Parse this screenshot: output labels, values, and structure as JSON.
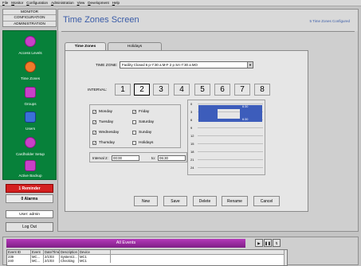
{
  "menu": [
    "File",
    "Monitor",
    "Configuration",
    "Administration",
    "View",
    "Development",
    "Help"
  ],
  "nav": {
    "top_items": [
      "MONITOR",
      "CONFIGURATION",
      "ADMINISTRATION"
    ],
    "items": [
      {
        "label": "Access Levels",
        "icon": "no-entry-icon"
      },
      {
        "label": "Time Zones",
        "icon": "clock-icon"
      },
      {
        "label": "Groups",
        "icon": "groups-icon"
      },
      {
        "label": "Users",
        "icon": "user-icon"
      },
      {
        "label": "Cardholder Setup",
        "icon": "cardholder-icon"
      },
      {
        "label": "Active Backup",
        "icon": "backup-icon"
      }
    ],
    "reminder": "1 Reminder",
    "alarms": "0 Alarms",
    "user": "User: admin",
    "logout": "Log Out"
  },
  "screen": {
    "title": "Time Zones Screen",
    "configured": "5 Time Zones Configured",
    "tabs": [
      "Time Zones",
      "Holidays"
    ],
    "tz_label": "TIME ZONE:",
    "tz_value": "Facility Closed 6 p-7:30 a M-F 2 p SA-7:30 a MO",
    "interval_label": "INTERVAL:",
    "intervals": [
      "1",
      "2",
      "3",
      "4",
      "5",
      "6",
      "7",
      "8"
    ],
    "selected_interval": "2",
    "days": [
      {
        "label": "Monday",
        "checked": true
      },
      {
        "label": "Tuesday",
        "checked": true
      },
      {
        "label": "Wednesday",
        "checked": true
      },
      {
        "label": "Thursday",
        "checked": true
      },
      {
        "label": "Friday",
        "checked": true
      },
      {
        "label": "Saturday",
        "checked": false
      },
      {
        "label": "Sunday",
        "checked": false
      },
      {
        "label": "Holidays",
        "checked": false
      }
    ],
    "interval2_label": "Interval 2:",
    "interval2_from": "00:00",
    "interval2_to_label": "to:",
    "interval2_to": "06:30",
    "timeline_ticks": [
      "0",
      "3",
      "6",
      "9",
      "12",
      "15",
      "18",
      "21",
      "24"
    ],
    "timeline_bar_labels": [
      "6:30",
      "6:30"
    ],
    "buttons": [
      "New",
      "Save",
      "Delete",
      "Rename",
      "Cancel"
    ]
  },
  "events": {
    "title": "All Events",
    "controls": [
      "▶",
      "❚❚",
      "↯"
    ],
    "columns": [
      "Event ID",
      "Event",
      "Date/Time",
      "Description",
      "Device"
    ],
    "rows": [
      [
        "239",
        "MC...",
        "2/1/03",
        "System/J...",
        "MC1"
      ],
      [
        "240",
        "MC...",
        "2/1/03",
        "Checking",
        "MC1"
      ]
    ]
  },
  "colors": {
    "nav_green": "#07813a",
    "title_blue": "#3a5ca8",
    "events_header": "#9a2aa0",
    "timeline_bar": "#3d5dbb",
    "reminder_red": "#d42020"
  }
}
